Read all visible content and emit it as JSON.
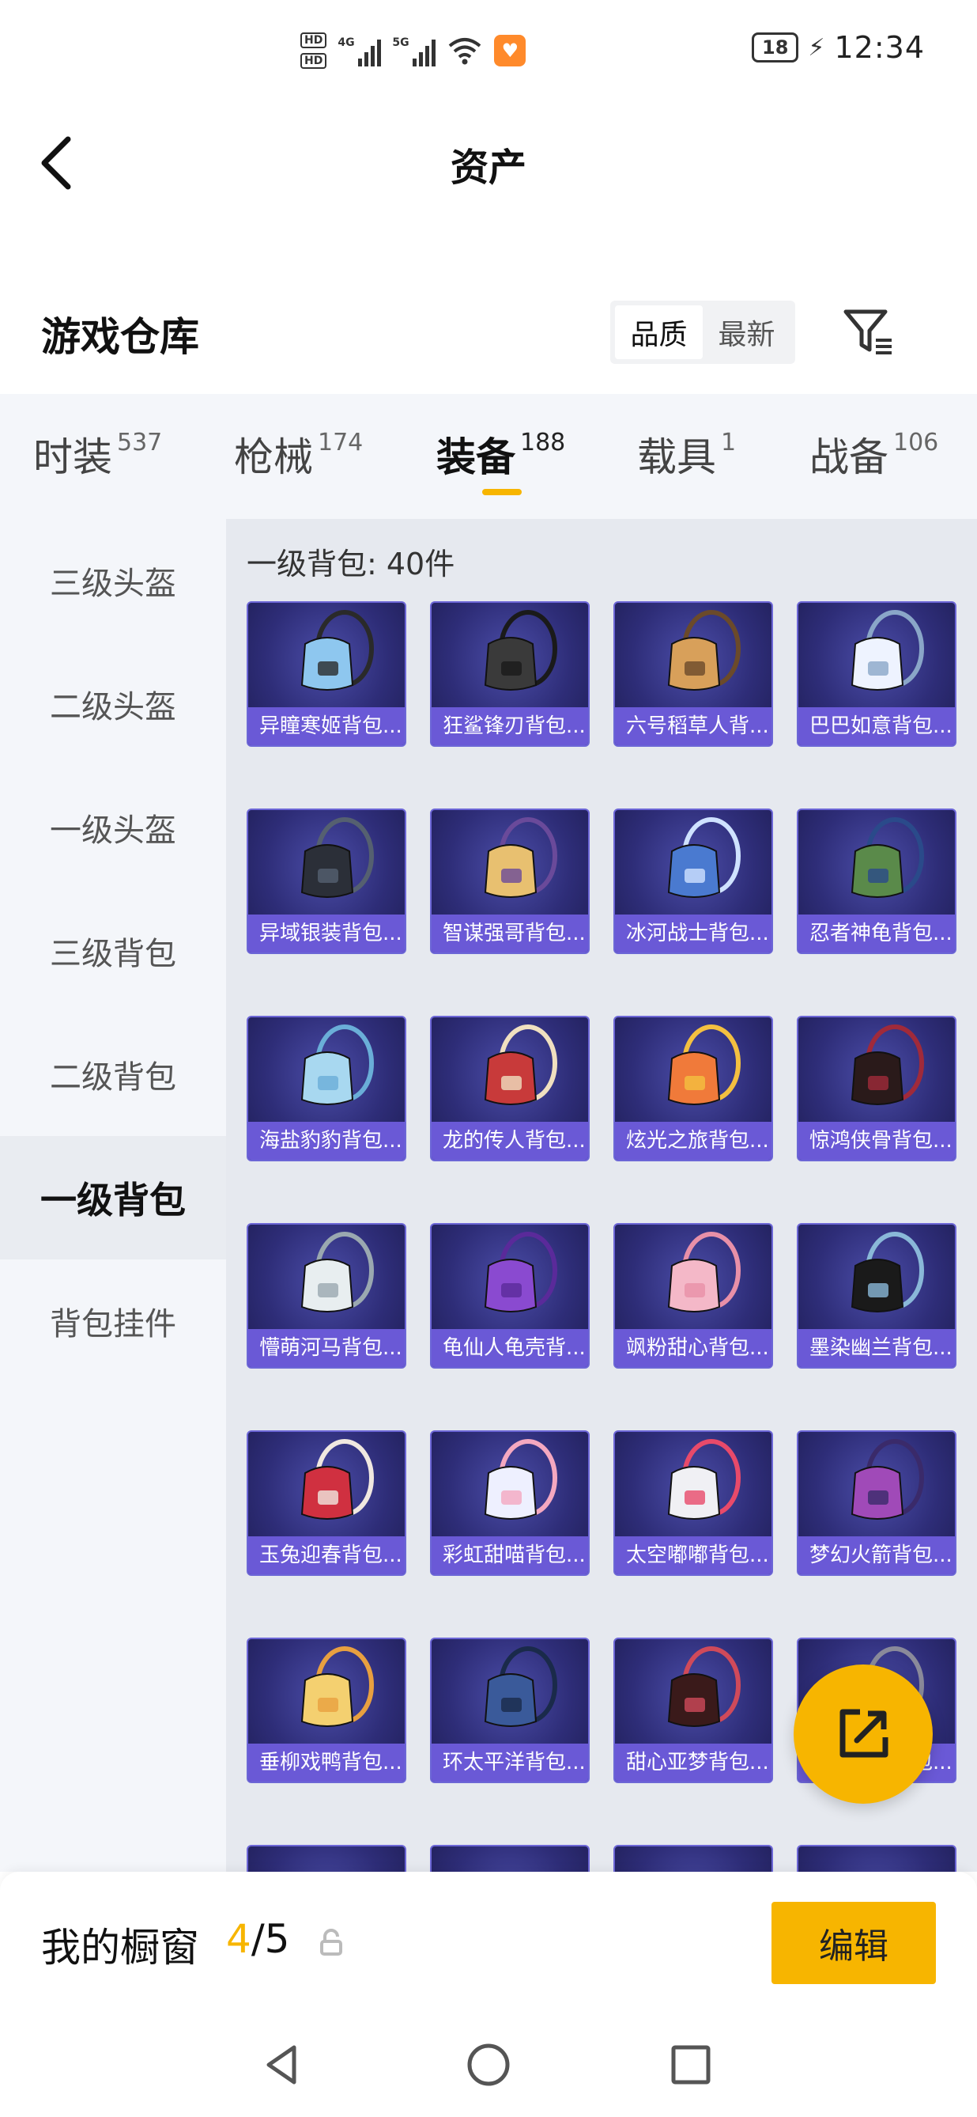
{
  "status_bar": {
    "hd1": "HD",
    "hd2": "HD",
    "net1": "4G",
    "net2": "5G",
    "wifi_label": "6",
    "battery": "18",
    "time": "12:34"
  },
  "header": {
    "title": "资产"
  },
  "warehouse": {
    "title": "游戏仓库",
    "sort_options": [
      "品质",
      "最新"
    ],
    "active_sort": "品质"
  },
  "tabs": [
    {
      "label": "时装",
      "count": "537"
    },
    {
      "label": "枪械",
      "count": "174"
    },
    {
      "label": "装备",
      "count": "188"
    },
    {
      "label": "载具",
      "count": "1"
    },
    {
      "label": "战备",
      "count": "106"
    }
  ],
  "active_tab": "装备",
  "side_nav": [
    "三级头盔",
    "二级头盔",
    "一级头盔",
    "三级背包",
    "二级背包",
    "一级背包",
    "背包挂件"
  ],
  "active_side": "一级背包",
  "section": {
    "title": "一级背包: 40件"
  },
  "items": [
    "异瞳寒姬背包...",
    "狂鲨锋刃背包...",
    "六号稻草人背...",
    "巴巴如意背包...",
    "异域银装背包...",
    "智谋强哥背包...",
    "冰河战士背包...",
    "忍者神龟背包...",
    "海盐豹豹背包...",
    "龙的传人背包...",
    "炫光之旅背包...",
    "惊鸿侠骨背包...",
    "懵萌河马背包...",
    "龟仙人龟壳背...",
    "飒粉甜心背包...",
    "墨染幽兰背包...",
    "玉兔迎春背包...",
    "彩虹甜喵背包...",
    "太空嘟嘟背包...",
    "梦幻火箭背包...",
    "垂柳戏鸭背包...",
    "环太平洋背包...",
    "甜心亚梦背包...",
    "飞驰魅影背包..."
  ],
  "showcase": {
    "label": "我的橱窗",
    "current": "4",
    "total": "/5"
  },
  "edit_button": "编辑",
  "colors": {
    "accent": "#f7b500",
    "item_label_bg": "#6a59d6",
    "item_bg": "#2e2d78"
  },
  "icons": {
    "back": "chevron-left-icon",
    "filter": "filter-icon",
    "share": "share-icon",
    "lock": "lock-icon",
    "nav_back": "triangle-back-icon",
    "nav_home": "circle-home-icon",
    "nav_recent": "square-recent-icon"
  }
}
